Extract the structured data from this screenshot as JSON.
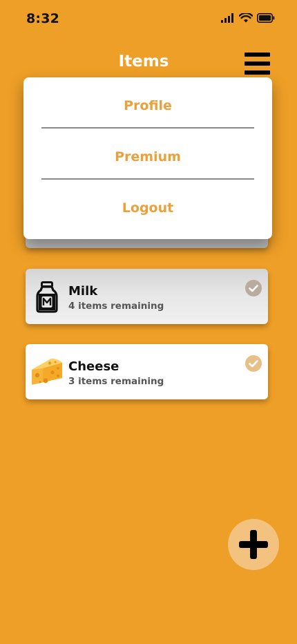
{
  "status_bar": {
    "time": "8:32"
  },
  "header": {
    "title": "Items"
  },
  "menu": {
    "items": [
      {
        "label": "Profile"
      },
      {
        "label": "Premium"
      },
      {
        "label": "Logout"
      }
    ]
  },
  "items": [
    {
      "name": "Milk",
      "remaining": "4 items remaining",
      "icon": "milk-bottle-icon"
    },
    {
      "name": "Cheese",
      "remaining": "3 items remaining",
      "icon": "cheese-icon"
    }
  ],
  "colors": {
    "background": "#EE9F27",
    "menu_text": "#E9A23B",
    "check": "#D9A45A",
    "fab": "#F3C27E"
  }
}
